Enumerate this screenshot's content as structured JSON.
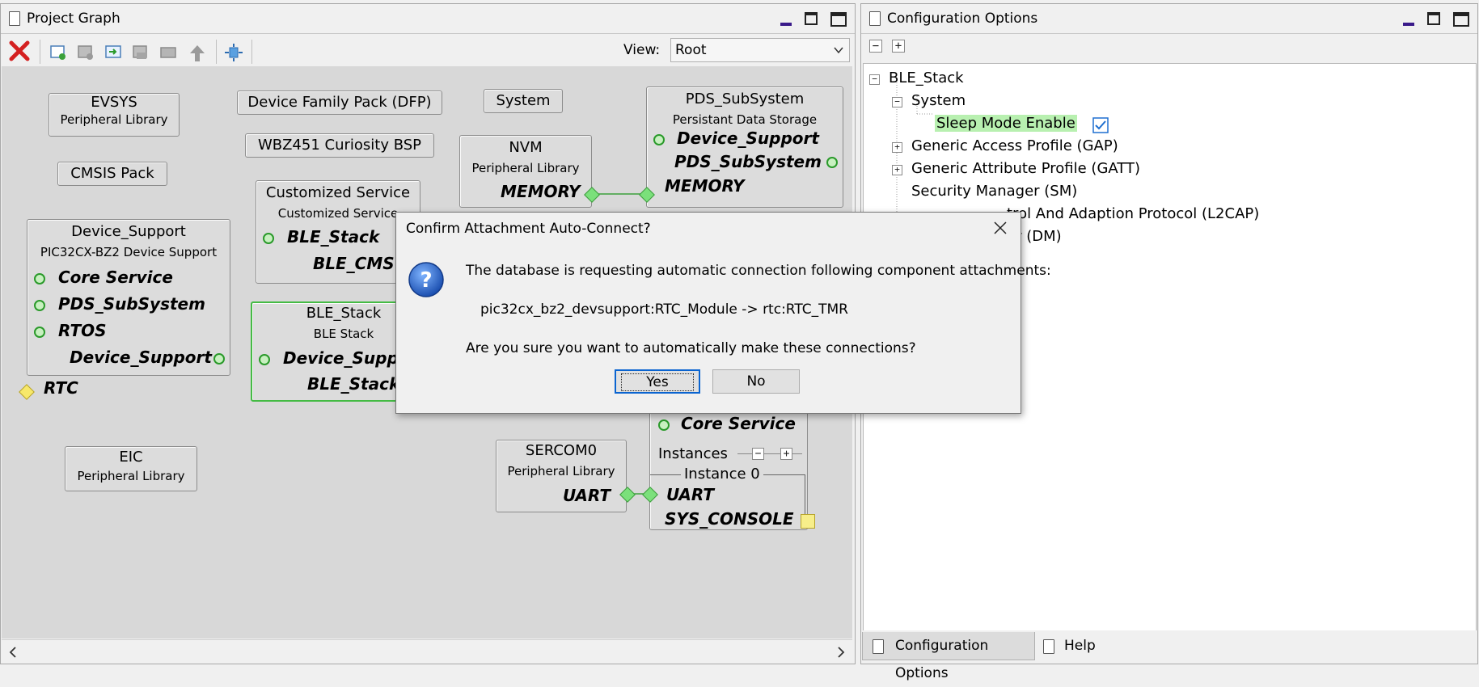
{
  "left_panel": {
    "title": "Project Graph",
    "view_label": "View:",
    "view_value": "Root"
  },
  "right_panel": {
    "title": "Configuration Options"
  },
  "nodes": {
    "evsys": {
      "title": "EVSYS",
      "sub": "Peripheral Library"
    },
    "dfp": {
      "title": "Device Family Pack (DFP)"
    },
    "system": {
      "title": "System"
    },
    "cmsis": {
      "title": "CMSIS Pack"
    },
    "bsp": {
      "title": "WBZ451 Curiosity BSP"
    },
    "nvm": {
      "title": "NVM",
      "sub": "Peripheral Library",
      "port": "MEMORY"
    },
    "pds": {
      "title": "PDS_SubSystem",
      "sub": "Persistant Data Storage",
      "ports": [
        "Device_Support",
        "PDS_SubSystem",
        "MEMORY"
      ]
    },
    "cms": {
      "title": "Customized Service",
      "sub": "Customized Service",
      "ports": [
        "BLE_Stack",
        "BLE_CMS"
      ]
    },
    "devsup": {
      "title": "Device_Support",
      "sub": "PIC32CX-BZ2 Device Support",
      "ports": [
        "Core Service",
        "PDS_SubSystem",
        "RTOS",
        "Device_Support",
        "RTC"
      ]
    },
    "ble": {
      "title": "BLE_Stack",
      "sub": "BLE Stack",
      "ports": [
        "Device_Support",
        "BLE_Stack"
      ]
    },
    "eic": {
      "title": "EIC",
      "sub": "Peripheral Library"
    },
    "sercom": {
      "title": "SERCOM0",
      "sub": "Peripheral Library",
      "port": "UART"
    },
    "console": {
      "core": "Core Service",
      "instances": "Instances",
      "instance0": "Instance 0",
      "ports": [
        "UART",
        "SYS_CONSOLE"
      ]
    }
  },
  "tree": {
    "root": "BLE_Stack",
    "system": "System",
    "sleep": "Sleep Mode Enable",
    "gap": "Generic Access Profile (GAP)",
    "gatt": "Generic Attribute Profile (GATT)",
    "sm": "Security Manager (SM)",
    "l2cap": "trol And Adaption Protocol (L2CAP)",
    "dm": "er (DM)"
  },
  "dialog": {
    "title": "Confirm Attachment Auto-Connect?",
    "message": "The database is requesting automatic connection following component attachments:",
    "connection": "pic32cx_bz2_devsupport:RTC_Module -> rtc:RTC_TMR",
    "question": "Are you sure you want to automatically make these connections?",
    "yes": "Yes",
    "no": "No"
  },
  "bottom_tabs": {
    "config": "Configuration Options",
    "help": "Help"
  },
  "colors": {
    "highlight": "#b8f0b0",
    "port_ok": "#2a9a2a",
    "selected_border": "#44bb44",
    "delete_red": "#d42020",
    "checkbox_blue": "#1e6fd0"
  },
  "icons": [
    "delete-icon",
    "new-icon",
    "save-icon",
    "import-icon",
    "export-icon",
    "folder-icon",
    "up-icon",
    "fit-icon",
    "question-icon",
    "close-icon",
    "checkbox-checked-icon"
  ]
}
